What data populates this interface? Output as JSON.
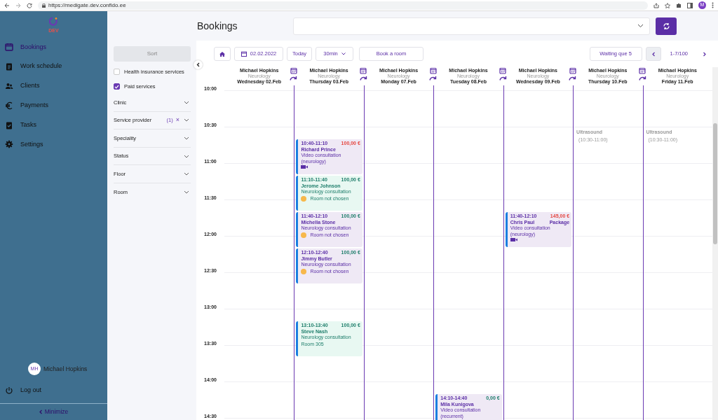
{
  "browser": {
    "url": "https://medigate.dev.confido.ee",
    "profile": "M"
  },
  "sidebar": {
    "badge": "DEV",
    "items": [
      {
        "label": "Bookings",
        "selected": true
      },
      {
        "label": "Work schedule",
        "selected": false
      },
      {
        "label": "Clients",
        "selected": false
      },
      {
        "label": "Payments",
        "selected": false
      },
      {
        "label": "Tasks",
        "selected": false
      },
      {
        "label": "Settings",
        "selected": false
      }
    ],
    "user": {
      "initials": "MH",
      "name": "Michael Hopkins"
    },
    "logout": "Log out",
    "minimize": "Minimize"
  },
  "filters": {
    "sort": "Sort",
    "checkboxes": [
      {
        "label": "Health insurance services",
        "checked": false
      },
      {
        "label": "Paid services",
        "checked": true
      }
    ],
    "groups": [
      {
        "label": "Clinic"
      },
      {
        "label": "Service provider",
        "count": "(1)",
        "clear": "×"
      },
      {
        "label": "Speciality"
      },
      {
        "label": "Status"
      },
      {
        "label": "Floor"
      },
      {
        "label": "Room"
      }
    ]
  },
  "page": {
    "title": "Bookings"
  },
  "toolbar": {
    "date": "02.02.2022",
    "today": "Today",
    "interval": "30min",
    "book_room": "Book a room",
    "waiting": "Waiting que 5",
    "pager": "1-7/100"
  },
  "calendar": {
    "times": [
      "10:00",
      "10:30",
      "11:00",
      "11:30",
      "12:00",
      "12:30",
      "13:00",
      "13:30",
      "14:00",
      "14:30"
    ],
    "days": [
      {
        "provider": "Michael Hopkins",
        "speciality": "Neurology",
        "date": "Wednesday 02.Feb"
      },
      {
        "provider": "Michael Hopkins",
        "speciality": "Neurology",
        "date": "Thursday 03.Feb",
        "events": [
          {
            "kind": "booking",
            "color": "#efe9f5",
            "time": "10:40-11:10",
            "price": "100,00 €",
            "paid": false,
            "client": "Richard Prince",
            "service": "Video consultation (neurology)",
            "video": true
          },
          {
            "kind": "booking",
            "color": "#e8f8f2",
            "time": "11:10-11:40",
            "price": "100,00 €",
            "paid": true,
            "client": "Jerome Johnson",
            "service": "Neurology consultation",
            "room": "Room not chosen",
            "room_warning": true
          },
          {
            "kind": "booking",
            "color": "#efe9f5",
            "time": "11:40-12:10",
            "price": "100,00 €",
            "paid": true,
            "client": "Michella Stone",
            "service": "Neurology consultation",
            "room": "Room not chosen",
            "room_warning": true
          },
          {
            "kind": "booking",
            "color": "#efe9f5",
            "time": "12:10-12:40",
            "price": "100,00 €",
            "paid": true,
            "client": "Jimmy Butler",
            "service": "Neurology consultation",
            "room": "Room not chosen",
            "room_warning": true
          },
          {
            "kind": "booking",
            "color": "#e8f8f2",
            "time": "13:10-13:40",
            "price": "100,00 €",
            "paid": true,
            "client": "Steve Nash",
            "service": "Neurology consultation",
            "room": "Room 305",
            "room_warning": false
          }
        ]
      },
      {
        "provider": "Michael Hopkins",
        "speciality": "Neurology",
        "date": "Monday 07.Feb"
      },
      {
        "provider": "Michael Hopkins",
        "speciality": "Neurology",
        "date": "Tuesday 08.Feb",
        "events": [
          {
            "kind": "booking",
            "color": "#efe9f5",
            "time": "14:10-14:40",
            "price": "0,00 €",
            "paid": true,
            "client": "Mila Kunigova",
            "service": "Video consultation (recurrent)"
          }
        ]
      },
      {
        "provider": "Michael Hopkins",
        "speciality": "Neurology",
        "date": "Wednesday 09.Feb",
        "events": [
          {
            "kind": "booking",
            "color": "#efe9f5",
            "time": "11:40-12:10",
            "price": "145,00 €",
            "paid": false,
            "client": "Chris Paul",
            "tag": "Package",
            "service": "Video consultation (neurology)",
            "video": true
          }
        ]
      },
      {
        "provider": "Michael Hopkins",
        "speciality": "Neurology",
        "date": "Thursday 10.Feb",
        "events": [
          {
            "kind": "block",
            "title": "Ultrasound",
            "time": "(10:30-11:00)"
          }
        ]
      },
      {
        "provider": "Michael Hopkins",
        "speciality": "Neurology",
        "date": "Friday 11.Feb",
        "events": [
          {
            "kind": "block",
            "title": "Ultrasound",
            "time": "(10:30-11:00)"
          }
        ]
      }
    ]
  }
}
